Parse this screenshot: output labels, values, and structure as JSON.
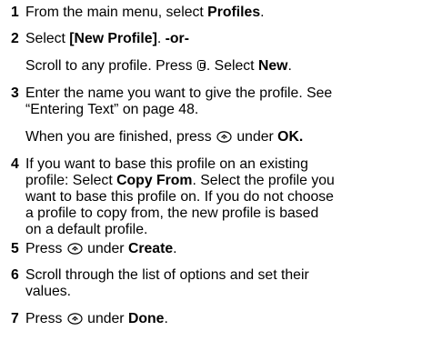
{
  "steps": [
    {
      "number": "1",
      "t1": "From the main menu, select ",
      "b1": "Profiles",
      "t2": "."
    },
    {
      "number": "2",
      "t1": "Select ",
      "b1": "[New Profile]",
      "t2": ". ",
      "b2": "-or-",
      "p2_t1": "Scroll to any profile. Press ",
      "p2_t2": ". Select ",
      "p2_b1": "New",
      "p2_t3": "."
    },
    {
      "number": "3",
      "l1": "Enter the name you want to give the profile. See",
      "l2": "“Entering Text” on page 48.",
      "p2_t1": "When you are finished, press ",
      "p2_t2": " under ",
      "p2_b1": "OK.",
      "p2_t3": ""
    },
    {
      "number": "4",
      "l1": "If you want to base this profile on an existing",
      "l2_t1": "profile: Select ",
      "l2_b1": "Copy From",
      "l2_t2": ". Select the profile you",
      "l3": "want to base this profile on. If you do not choose",
      "l4": "a profile to copy from, the new profile is based",
      "l5": "on a default profile."
    },
    {
      "number": "5",
      "t1": "Press ",
      "t2": " under ",
      "b1": "Create",
      "t3": "."
    },
    {
      "number": "6",
      "l1": "Scroll through the list of options and set their",
      "l2": "values."
    },
    {
      "number": "7",
      "t1": "Press ",
      "t2": " under ",
      "b1": "Done",
      "t3": "."
    }
  ],
  "icons": [
    "menu-key-icon",
    "navigation-key-icon"
  ]
}
